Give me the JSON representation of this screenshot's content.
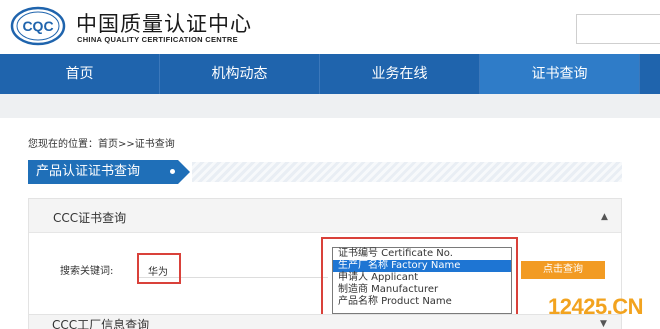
{
  "header": {
    "logo_text": "CQC",
    "brand_cn": "中国质量认证中心",
    "brand_en": "CHINA QUALITY CERTIFICATION CENTRE"
  },
  "nav": {
    "items": [
      {
        "label": "首页"
      },
      {
        "label": "机构动态"
      },
      {
        "label": "业务在线"
      },
      {
        "label": "证书查询"
      }
    ]
  },
  "breadcrumb": "您现在的位置：首页>>证书查询",
  "section_title": "产品认证证书查询",
  "panel1": {
    "title": "CCC证书查询",
    "keyword_label": "搜索关键词:",
    "keyword_value": "华为",
    "options": [
      "证书编号 Certificate No.",
      "生产厂名称 Factory Name",
      "申请人 Applicant",
      "制造商 Manufacturer",
      "产品名称 Product Name"
    ],
    "selected_option": "生产厂名称 Factory Name",
    "search_button": "点击查询"
  },
  "panel2": {
    "title": "CCC工厂信息查询"
  },
  "watermark": "12425.CN",
  "colors": {
    "nav_bg": "#1f64ad",
    "nav_active": "#2f7cc8",
    "accent_orange": "#f29b23",
    "highlight_red": "#d9413a",
    "selected_blue": "#1e75d3"
  }
}
